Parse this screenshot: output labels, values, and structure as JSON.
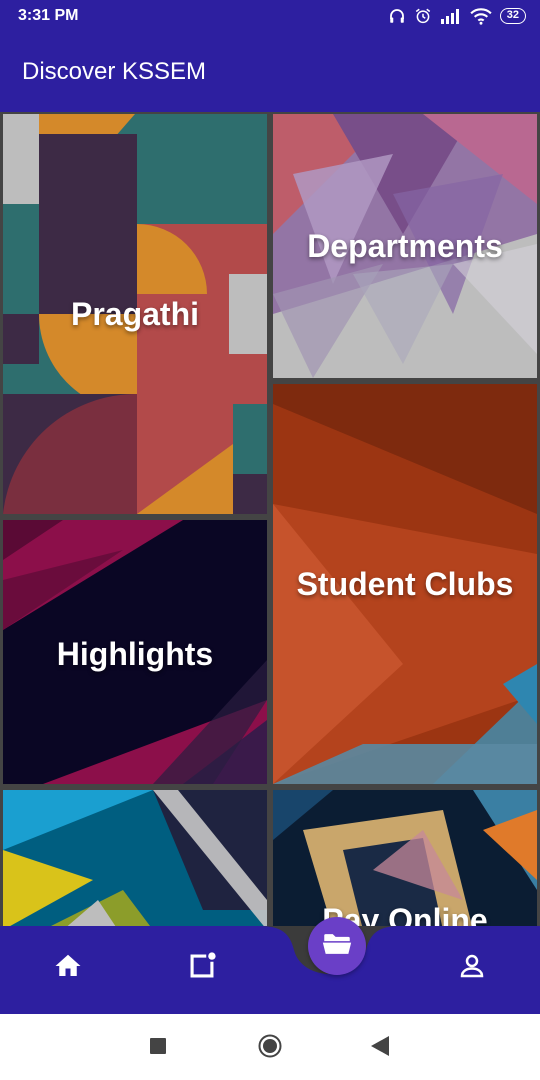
{
  "status_bar": {
    "time": "3:31 PM",
    "battery": "32",
    "icons": [
      "headphones-icon",
      "alarm-icon",
      "signal-icon",
      "wifi-icon",
      "battery-icon"
    ]
  },
  "app_bar": {
    "title": "Discover KSSEM"
  },
  "tiles": [
    {
      "label": "Pragathi"
    },
    {
      "label": "Departments"
    },
    {
      "label": "Highlights"
    },
    {
      "label": "Student Clubs"
    },
    {
      "label": ""
    },
    {
      "label": "Pay Online"
    }
  ],
  "bottom_nav": {
    "items": [
      "home-icon",
      "notifications-icon",
      "folder-icon",
      "profile-icon"
    ]
  },
  "system_nav": {
    "items": [
      "recents-button",
      "home-button",
      "back-button"
    ]
  },
  "colors": {
    "primary": "#2d1fa0",
    "fab": "#6a3fc7",
    "grid_gap": "#444444"
  }
}
